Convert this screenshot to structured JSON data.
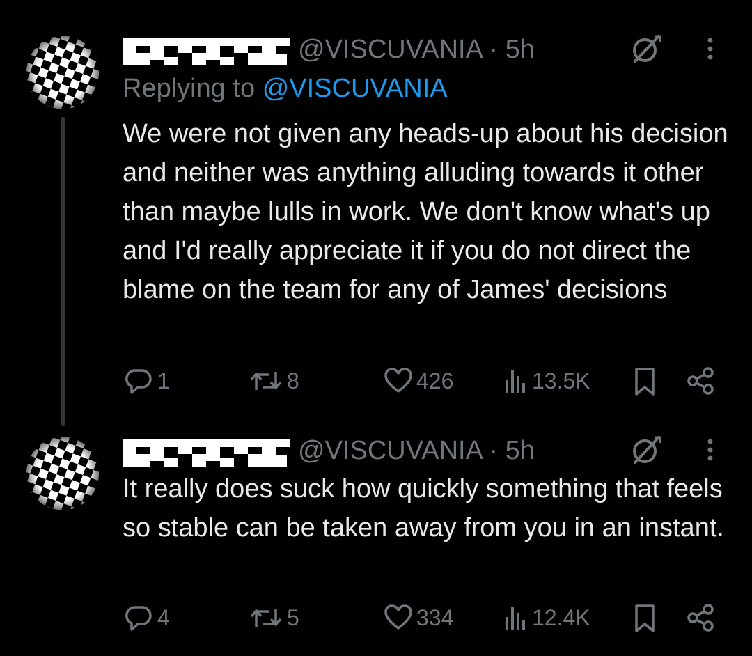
{
  "tweets": [
    {
      "handle": "@VISCUVANIA",
      "separator": "·",
      "time": "5h",
      "replying_prefix": "Replying to",
      "replying_to": "@VISCUVANIA",
      "text": "We were not given any heads-up about his decision and neither was anything alluding towards it other than maybe lulls in work. We don't know what's up and I'd really appreciate it if you do not direct the blame on the team for any of James' decisions",
      "stats": {
        "replies": "1",
        "reposts": "8",
        "likes": "426",
        "views": "13.5K"
      }
    },
    {
      "handle": "@VISCUVANIA",
      "separator": "·",
      "time": "5h",
      "text": "It really does suck how quickly something that feels so stable can be taken away from you in an instant.",
      "stats": {
        "replies": "4",
        "reposts": "5",
        "likes": "334",
        "views": "12.4K"
      }
    }
  ],
  "colors": {
    "background": "#000000",
    "text": "#e7e9ea",
    "muted": "#71767b",
    "link": "#1d9bf0"
  },
  "icons": [
    "avatar-checkered-sphere",
    "grok-icon",
    "more-icon",
    "reply-icon",
    "repost-icon",
    "like-icon",
    "views-icon",
    "bookmark-icon",
    "share-icon"
  ]
}
